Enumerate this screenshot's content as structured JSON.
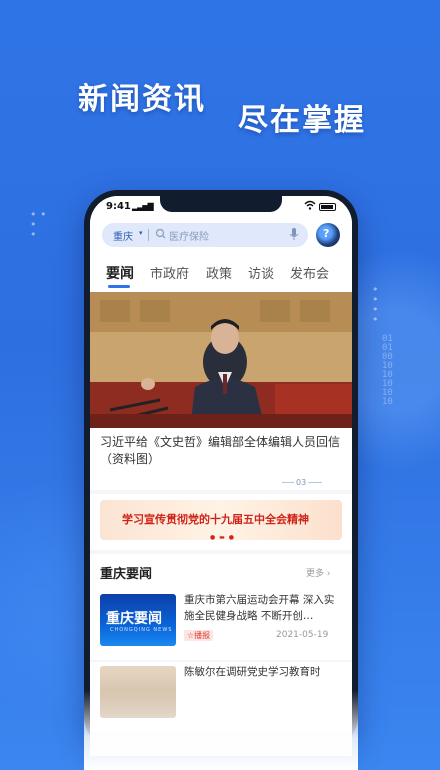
{
  "promo": {
    "headline_left": "新闻资讯",
    "headline_right": "尽在掌握"
  },
  "status_bar": {
    "time": "9:41"
  },
  "search": {
    "city": "重庆",
    "placeholder": "医疗保险"
  },
  "tabs": [
    {
      "label": "要闻",
      "active": true
    },
    {
      "label": "市政府",
      "active": false
    },
    {
      "label": "政策",
      "active": false
    },
    {
      "label": "访谈",
      "active": false
    },
    {
      "label": "发布会",
      "active": false
    }
  ],
  "hero": {
    "caption": "习近平给《文史哲》编辑部全体编辑人员回信（资料图）",
    "page_indicator": "03"
  },
  "banner": {
    "text": "学习宣传贯彻党的十九届五中全会精神"
  },
  "section": {
    "title": "重庆要闻",
    "more_label": "更多"
  },
  "news": [
    {
      "thumb_title": "重庆要闻",
      "thumb_subtitle": "CHONGQING NEWS",
      "title": "重庆市第六届运动会开幕 深入实施全民健身战略 不断开创…",
      "tag": "☆播报",
      "date": "2021-05-19"
    },
    {
      "title": "陈敏尔在调研党史学习教育时"
    }
  ],
  "colors": {
    "brand_blue": "#2f74e6",
    "banner_red": "#d0231a",
    "tag_red": "#e0403a"
  }
}
